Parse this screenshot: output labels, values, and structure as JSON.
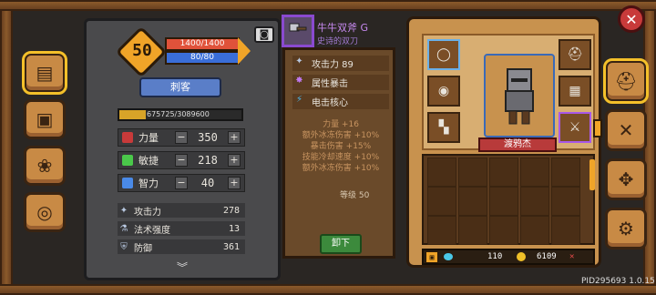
{
  "player": {
    "level": "50",
    "hp": "1400/1400",
    "mp": "80/80",
    "class_name": "刺客",
    "exp": "675725/3089600",
    "exp_fraction": 0.22
  },
  "attributes": [
    {
      "label": "力量",
      "value": "350",
      "color": "#c83a3a"
    },
    {
      "label": "敏捷",
      "value": "218",
      "color": "#4ac84a"
    },
    {
      "label": "智力",
      "value": "40",
      "color": "#4a8ae8"
    }
  ],
  "attr_buttons": {
    "minus": "−",
    "plus": "+"
  },
  "combat_stats": [
    {
      "label": "攻击力",
      "value": "278",
      "icon": "✦"
    },
    {
      "label": "法术强度",
      "value": "13",
      "icon": "⚗"
    },
    {
      "label": "防御",
      "value": "361",
      "icon": "⛨"
    }
  ],
  "scroll_chevron": "︾",
  "camera_icon": "◙",
  "item": {
    "name": "牛牛双斧 G",
    "subtitle": "史诗的双刀",
    "detail_rows": [
      {
        "label": "攻击力 89",
        "icon": "✦",
        "icon_color": "#b8c8e0"
      },
      {
        "label": "属性暴击",
        "icon": "✸",
        "icon_color": "#c078f0"
      },
      {
        "label": "电击核心",
        "icon": "⚡",
        "icon_color": "#4ab8f0"
      }
    ],
    "bonuses": [
      "力量 +16",
      "额外冰冻伤害 +10%",
      "暴击伤害 +15%",
      "技能冷却速度 +10%",
      "额外冰冻伤害 +10%"
    ],
    "level_label": "等级 50",
    "unequip_label": "卸下"
  },
  "hero": {
    "name": "渡鸦杰"
  },
  "currency": {
    "gems": "110",
    "coins": "6109",
    "mark": "✕"
  },
  "close_label": "✕",
  "version": "PID295693 1.0.15",
  "left_tabs": [
    "book-icon",
    "chest-icon",
    "gear-bag-icon",
    "wheel-icon"
  ],
  "right_tabs": [
    "helmet-icon",
    "crossed-tools-icon",
    "compass-icon",
    "settings-icon"
  ]
}
